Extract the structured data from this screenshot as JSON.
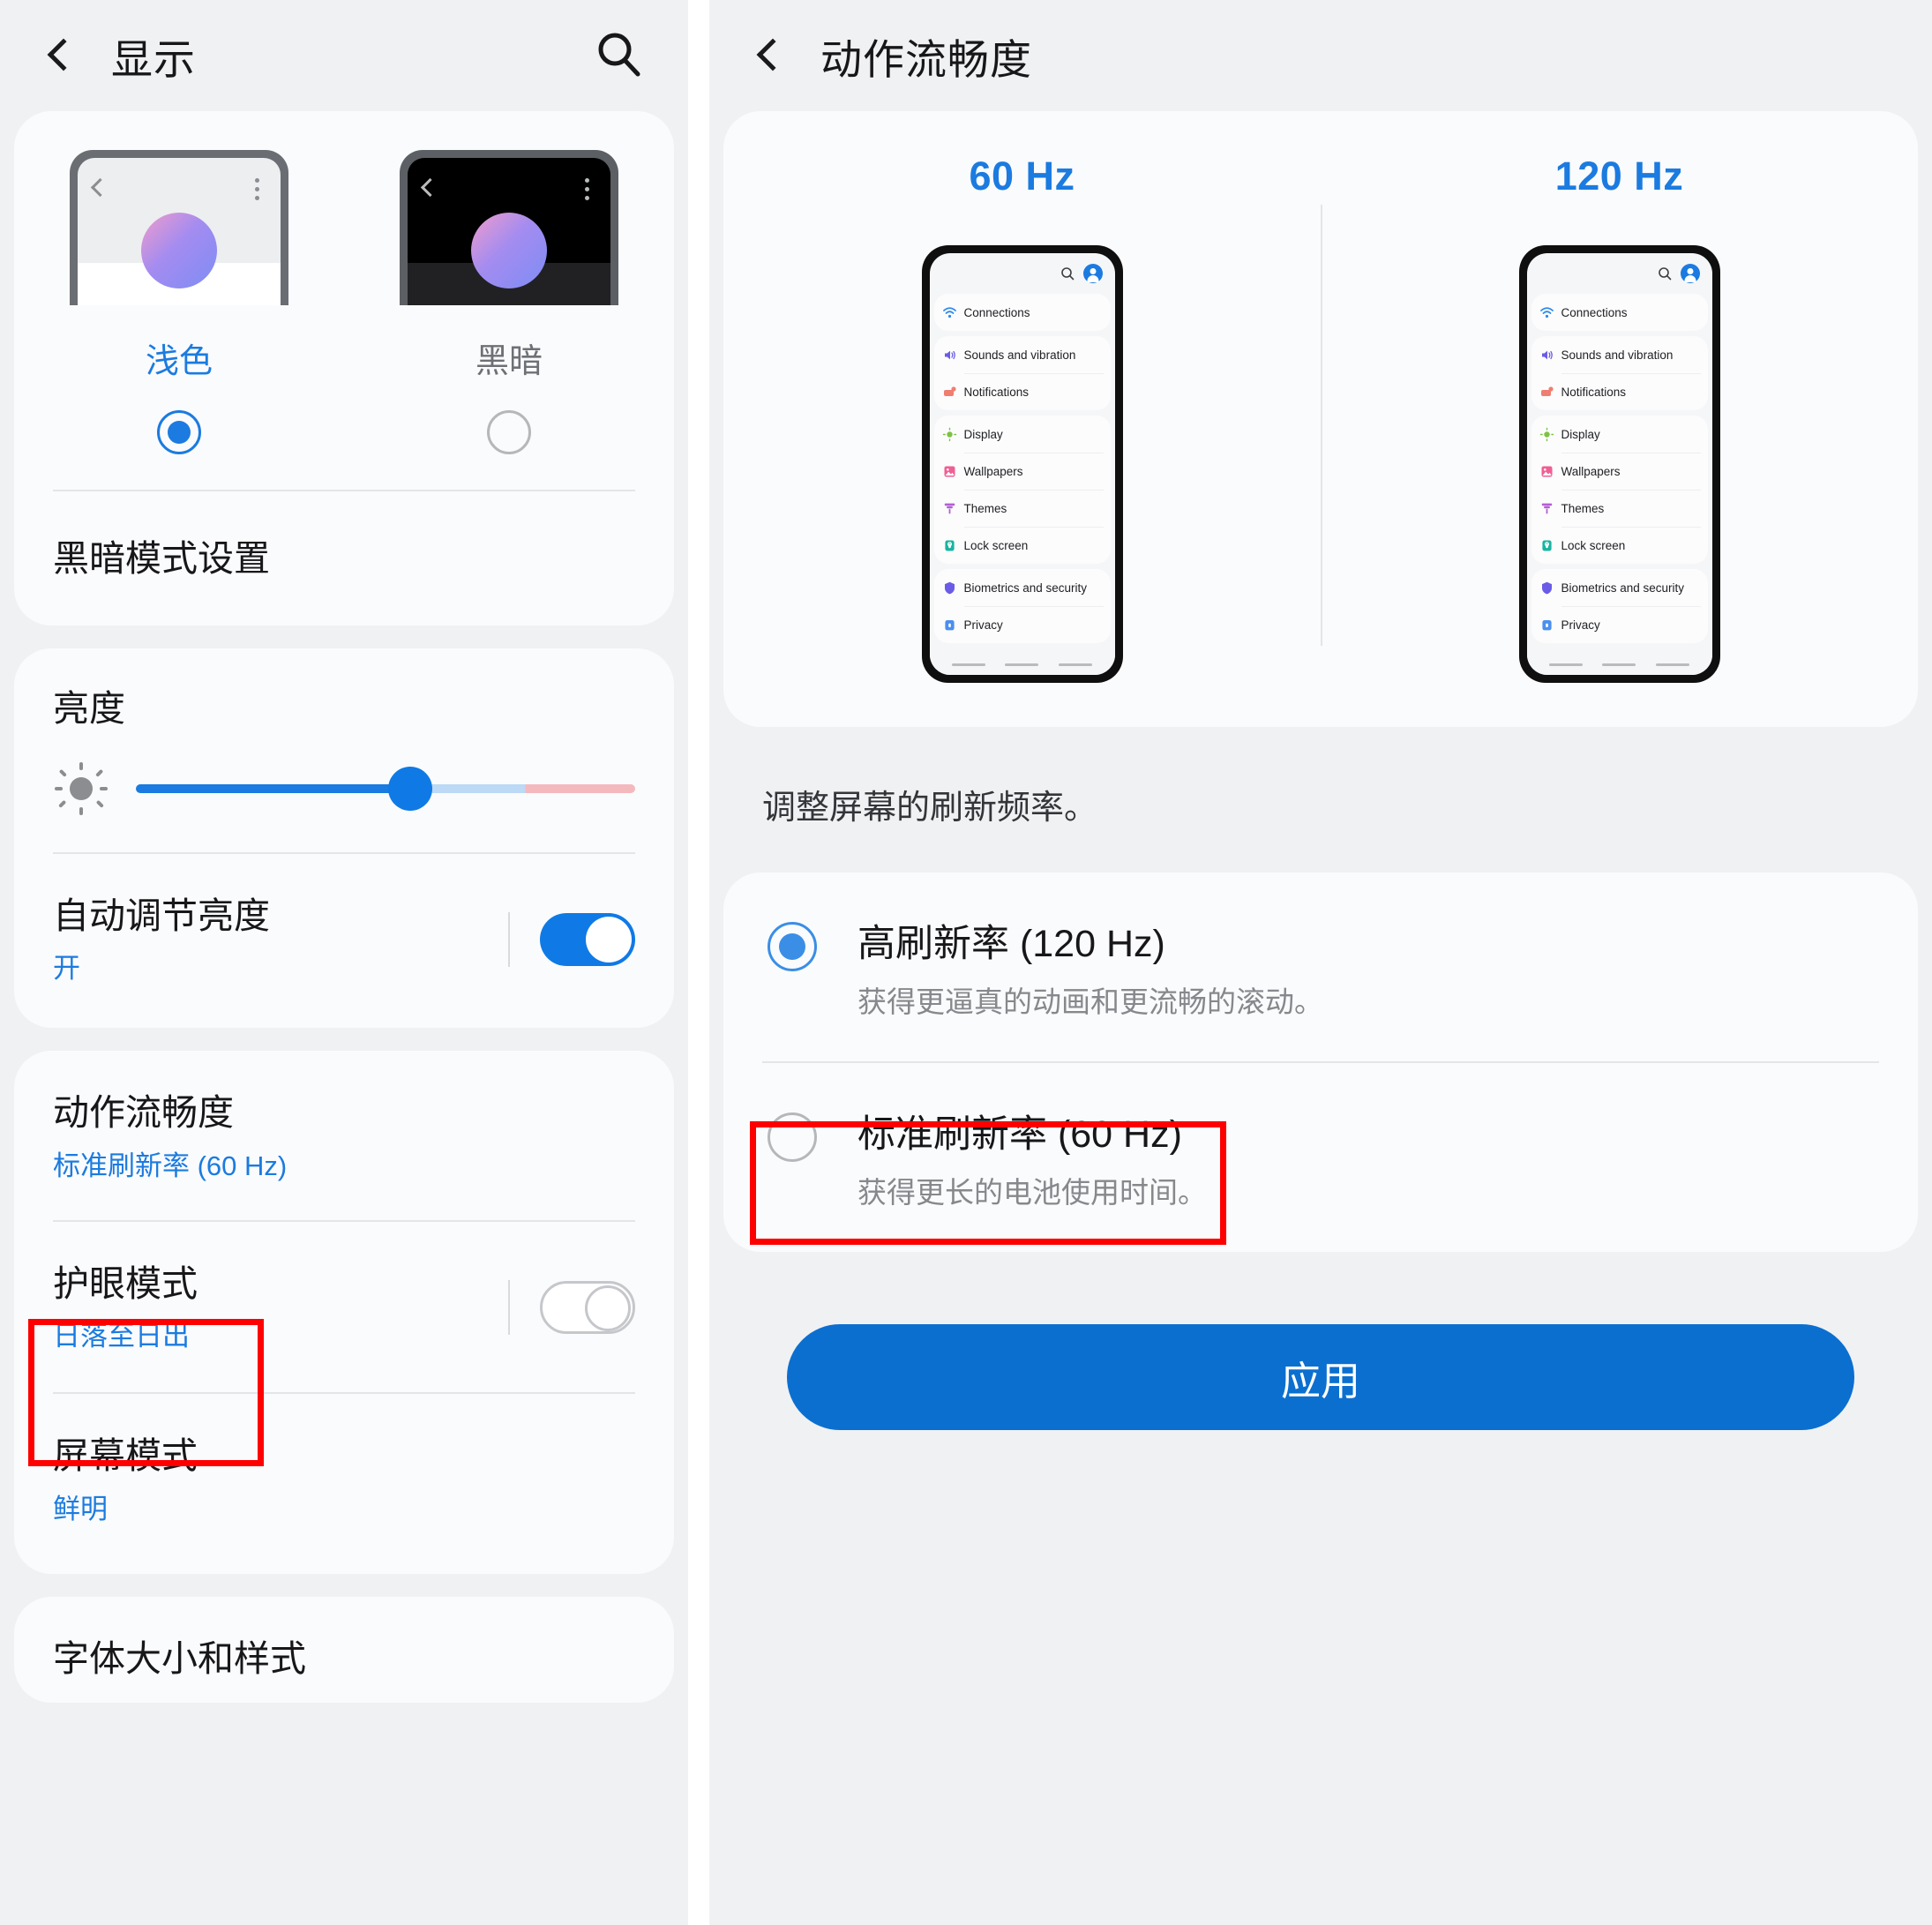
{
  "left": {
    "appbar": {
      "title": "显示",
      "back_icon": "chevron-left-icon",
      "search_icon": "search-icon"
    },
    "theme": {
      "options": [
        {
          "label": "浅色",
          "selected": true
        },
        {
          "label": "黑暗",
          "selected": false
        }
      ],
      "dark_mode_settings": "黑暗模式设置"
    },
    "brightness": {
      "title": "亮度",
      "icon": "brightness-icon",
      "value_percent": 55
    },
    "auto_brightness": {
      "title": "自动调节亮度",
      "sub": "开",
      "toggle": "on"
    },
    "motion_smoothness": {
      "title": "动作流畅度",
      "sub": "标准刷新率 (60 Hz)",
      "highlighted": true
    },
    "eye_comfort": {
      "title": "护眼模式",
      "sub": "日落至日出",
      "toggle": "off"
    },
    "screen_mode": {
      "title": "屏幕模式",
      "sub": "鲜明"
    },
    "font_size": {
      "title": "字体大小和样式"
    }
  },
  "right": {
    "appbar": {
      "title": "动作流畅度",
      "back_icon": "chevron-left-icon"
    },
    "preview": {
      "columns": [
        {
          "label": "60 Hz"
        },
        {
          "label": "120 Hz"
        }
      ],
      "mock_items": [
        {
          "label": "Connections",
          "icon": "wifi-icon",
          "color": "#2f8ae8"
        },
        {
          "label": "Sounds and vibration",
          "icon": "speaker-icon",
          "color": "#6b5ce7"
        },
        {
          "label": "Notifications",
          "icon": "notification-icon",
          "color": "#ef7e70"
        },
        {
          "label": "Display",
          "icon": "display-icon",
          "color": "#7ec242"
        },
        {
          "label": "Wallpapers",
          "icon": "wallpaper-icon",
          "color": "#ef5f93"
        },
        {
          "label": "Themes",
          "icon": "themes-icon",
          "color": "#b35fd4"
        },
        {
          "label": "Lock screen",
          "icon": "lock-icon",
          "color": "#18b5a0"
        },
        {
          "label": "Biometrics and security",
          "icon": "shield-icon",
          "color": "#6b5ce7"
        },
        {
          "label": "Privacy",
          "icon": "privacy-icon",
          "color": "#4a8ff0"
        }
      ]
    },
    "description": "调整屏幕的刷新频率。",
    "options": [
      {
        "title": "高刷新率 (120 Hz)",
        "sub": "获得更逼真的动画和更流畅的滚动。",
        "selected": true,
        "highlighted": true
      },
      {
        "title": "标准刷新率 (60 Hz)",
        "sub": "获得更长的电池使用时间。",
        "selected": false,
        "highlighted": false
      }
    ],
    "apply_label": "应用"
  },
  "colors": {
    "accent_blue": "#1b7be0",
    "button_blue": "#0b6fd0",
    "highlight_red": "#fe0000",
    "page_bg": "#f0f1f3",
    "card_bg": "#fafbfc"
  }
}
